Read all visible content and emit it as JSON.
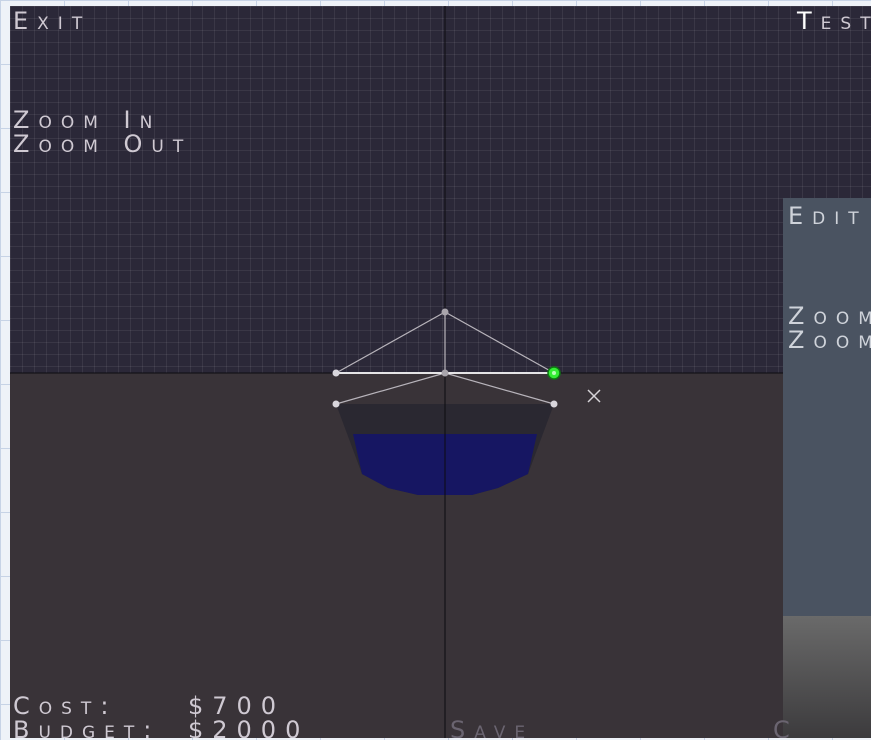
{
  "menu": {
    "exit_label": "Exit",
    "test_first": "T",
    "test_rest": "est",
    "zoom_in_label": "Zoom In",
    "zoom_out_label": "Zoom Out"
  },
  "panel": {
    "edit_label": "Edit",
    "zoom_in_label": "Zoom",
    "zoom_out_label": "Zoom"
  },
  "footer": {
    "cost_label": "Cost:",
    "cost_value": "$700",
    "budget_label": "Budget:",
    "budget_value": "$2000",
    "save_label": "Save",
    "right_partial": "C"
  },
  "colors": {
    "sky": "#2b2838",
    "ground": "#393338",
    "water": "#161662",
    "selected_joint": "#33ee33",
    "panel": "#4a5361"
  },
  "icons": {
    "cursor": "crosshair-x-icon",
    "joint": "joint-node-icon"
  }
}
